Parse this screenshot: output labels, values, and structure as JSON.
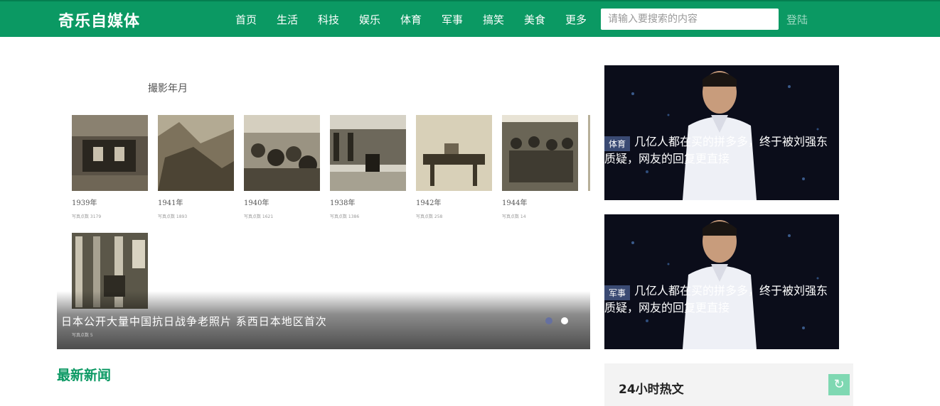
{
  "header": {
    "logo": "奇乐自媒体",
    "nav": [
      "首页",
      "生活",
      "科技",
      "娱乐",
      "体育",
      "军事",
      "搞笑",
      "美食",
      "更多"
    ],
    "search_placeholder": "请输入要搜索的内容",
    "login": "登陆"
  },
  "carousel": {
    "album_title": "撮影年月",
    "photos": [
      {
        "year": "1939年",
        "count": "写真点数  3179"
      },
      {
        "year": "1941年",
        "count": "写真点数  1893"
      },
      {
        "year": "1940年",
        "count": "写真点数  1621"
      },
      {
        "year": "1938年",
        "count": "写真点数  1386"
      },
      {
        "year": "1942年",
        "count": "写真点数  258"
      },
      {
        "year": "1944年",
        "count": "写真点数  14"
      }
    ],
    "last_photo_count": "写真点数  5",
    "caption": "日本公开大量中国抗日战争老照片 系西日本地区首次",
    "active_dot": 0
  },
  "side_cards": [
    {
      "tag": "体育",
      "title": "几亿人都在买的拼多多，终于被刘强东质疑，网友的回复更直接"
    },
    {
      "tag": "军事",
      "title": "几亿人都在买的拼多多，终于被刘强东质疑，网友的回复更直接"
    }
  ],
  "latest_news": "最新新闻",
  "hot": {
    "title": "24小时热文",
    "refresh_icon": "refresh-icon"
  },
  "colors": {
    "brand": "#0b9963",
    "tag_bg": "#3a4a73"
  }
}
